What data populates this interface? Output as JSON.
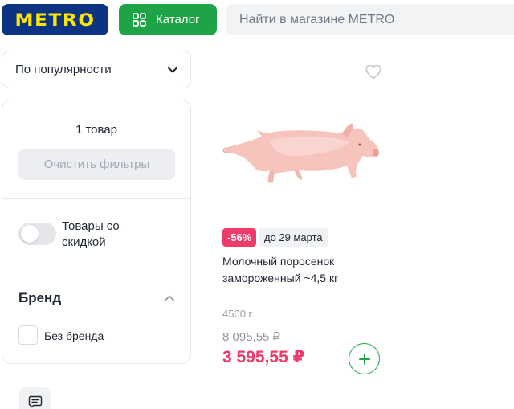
{
  "header": {
    "logo_text": "METRO",
    "catalog_label": "Каталог",
    "search_placeholder": "Найти в магазине METRO"
  },
  "sort": {
    "selected": "По популярности"
  },
  "filters": {
    "count_text": "1 товар",
    "clear_label": "Очистить фильтры",
    "discount_toggle_label": "Товары со скидкой",
    "discount_toggle_on": false,
    "brand_title": "Бренд",
    "brand_options": [
      {
        "label": "Без бренда",
        "checked": false
      }
    ]
  },
  "product": {
    "discount_badge": "-56%",
    "promo_until": "до 29 марта",
    "title": "Молочный поросенок замороженный ~4,5 кг",
    "weight": "4500 г",
    "old_price": "8 095,55 ₽",
    "new_price": "3 595,55 ₽"
  },
  "colors": {
    "brand_blue": "#0d3482",
    "brand_yellow": "#ffe500",
    "accent_green": "#1fa347",
    "sale_pink": "#ef3b6a"
  },
  "icons": [
    "grid-icon",
    "chevron-down-icon",
    "chevron-up-icon",
    "heart-icon",
    "plus-icon",
    "chat-icon"
  ]
}
